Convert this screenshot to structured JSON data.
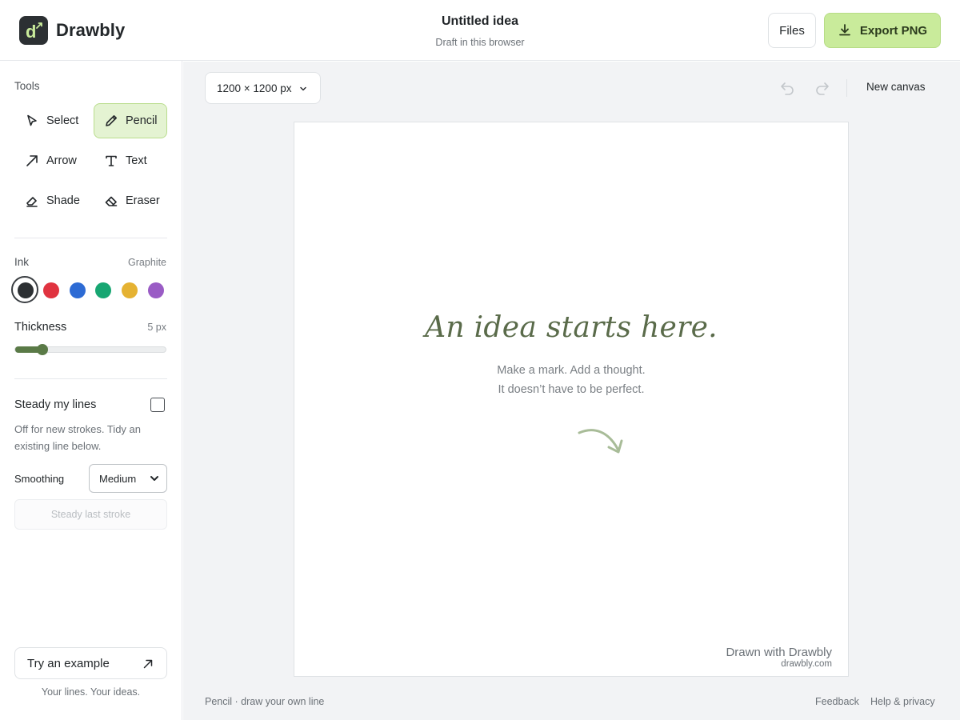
{
  "app": {
    "name": "Drawbly",
    "doc_title": "Untitled idea",
    "doc_subtitle": "Draft in this browser",
    "files_label": "Files",
    "export_label": "Export PNG",
    "accent_color": "#c9eb9b"
  },
  "sidebar": {
    "tools_label": "Tools",
    "tools": [
      {
        "label": "Select",
        "icon": "cursor-icon",
        "active": false
      },
      {
        "label": "Pencil",
        "icon": "pencil-icon",
        "active": true
      },
      {
        "label": "Arrow",
        "icon": "arrow-icon",
        "active": false
      },
      {
        "label": "Text",
        "icon": "text-icon",
        "active": false
      },
      {
        "label": "Shade",
        "icon": "shade-icon",
        "active": false
      },
      {
        "label": "Eraser",
        "icon": "eraser-icon",
        "active": false
      }
    ],
    "ink_label": "Ink",
    "ink_name": "Graphite",
    "inks": [
      {
        "color": "#2c3033",
        "selected": true
      },
      {
        "color": "#e03340",
        "selected": false
      },
      {
        "color": "#2d6bd4",
        "selected": false
      },
      {
        "color": "#17a672",
        "selected": false
      },
      {
        "color": "#e5b232",
        "selected": false
      },
      {
        "color": "#9a5cc5",
        "selected": false
      }
    ],
    "thickness_label": "Thickness",
    "thickness_value": "5 px",
    "thickness_fraction": 0.18,
    "steady_label": "Steady my lines",
    "steady_checked": false,
    "steady_help": "Off for new strokes. Tidy an existing line below.",
    "smoothing_label": "Smoothing",
    "smoothing_value": "Medium",
    "steady_button_label": "Steady last stroke",
    "example_button_label": "Try an example",
    "tagline": "Your lines. Your ideas."
  },
  "main": {
    "canvas_size": "1200 × 1200 px",
    "new_canvas_label": "New canvas",
    "headline": "An idea starts here.",
    "sub_line_1": "Make a mark. Add a thought.",
    "sub_line_2": "It doesn’t have to be perfect.",
    "watermark_title": "Drawn with Drawbly",
    "watermark_url": "drawbly.com",
    "footer_status": "Pencil · draw your own line",
    "footer_feedback": "Feedback",
    "footer_help": "Help & privacy"
  }
}
